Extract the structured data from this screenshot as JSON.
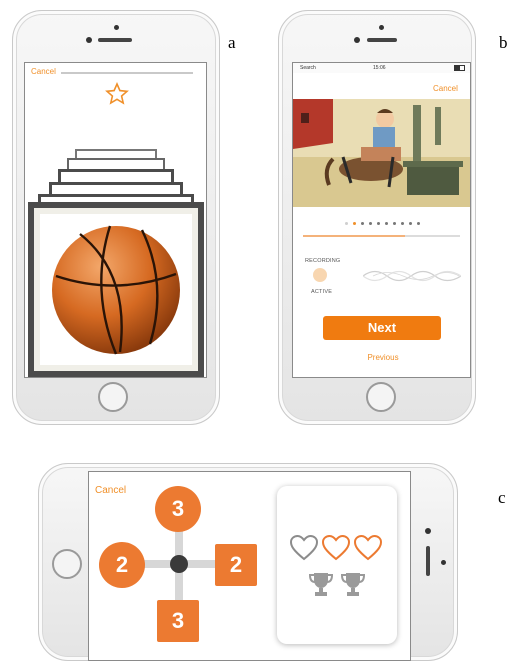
{
  "labels": {
    "a": "a",
    "b": "b",
    "c": "c"
  },
  "screen_a": {
    "cancel": "Cancel",
    "star_icon": "star-outline-icon",
    "card_image": "basketball"
  },
  "screen_b": {
    "status": {
      "carrier": "Search",
      "time": "15:06",
      "battery": "battery-icon"
    },
    "cancel": "Cancel",
    "illustration": "boy-with-dog-cartoon",
    "page_dots": {
      "total": 10,
      "active": 2
    },
    "progress": 0.65,
    "recording_label": "RECORDING",
    "active_label": "ACTIVE",
    "next_label": "Next",
    "previous_label": "Previous"
  },
  "screen_c": {
    "cancel": "Cancel",
    "nodes": {
      "top": "3",
      "left": "2",
      "right": "2",
      "bottom": "3"
    },
    "hearts": {
      "total": 3,
      "outline_gray": 1,
      "outline_orange": 2
    },
    "trophies": 2
  },
  "colors": {
    "accent": "#f07b10",
    "node": "#ec7a31",
    "heart_orange": "#ec7a31",
    "gray": "#8c8c8c"
  }
}
